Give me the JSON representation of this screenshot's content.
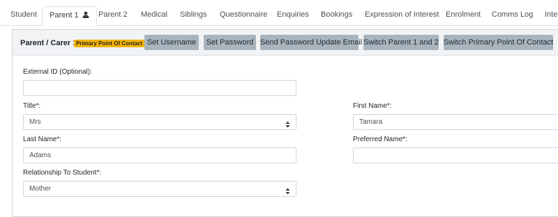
{
  "tabs": [
    {
      "label": "Student"
    },
    {
      "label": "Parent 1",
      "icon": "user-icon",
      "active": true
    },
    {
      "label": "Parent 2"
    },
    {
      "label": "Medical"
    },
    {
      "label": "Siblings"
    },
    {
      "label": "Questionnaire"
    },
    {
      "label": "Enquiries"
    },
    {
      "label": "Bookings"
    },
    {
      "label": "Expression of Interest"
    },
    {
      "label": "Enrolment"
    },
    {
      "label": "Comms Log"
    },
    {
      "label": "Inter"
    }
  ],
  "panel": {
    "title": "Parent / Carer 1",
    "badge": "Primary Point Of Contact",
    "badge_color": "#f5b301",
    "buttons": {
      "set_username": "Set Username",
      "set_password": "Set Password",
      "send_password_update": "Send Password Update Email",
      "switch_parents": "Switch Parent 1 and 2",
      "switch_primary": "Switch Primary Point Of Contact"
    }
  },
  "form": {
    "external_id": {
      "label": "External ID (Optional):",
      "value": ""
    },
    "title": {
      "label": "Title*:",
      "value": "Mrs"
    },
    "last_name": {
      "label": "Last Name*:",
      "value": "Adams"
    },
    "relationship": {
      "label": "Relationship To Student*:",
      "value": "Mother"
    },
    "first_name": {
      "label": "First Name*:",
      "value": "Tamara"
    },
    "preferred_name": {
      "label": "Preferred Name*:",
      "value": ""
    }
  }
}
